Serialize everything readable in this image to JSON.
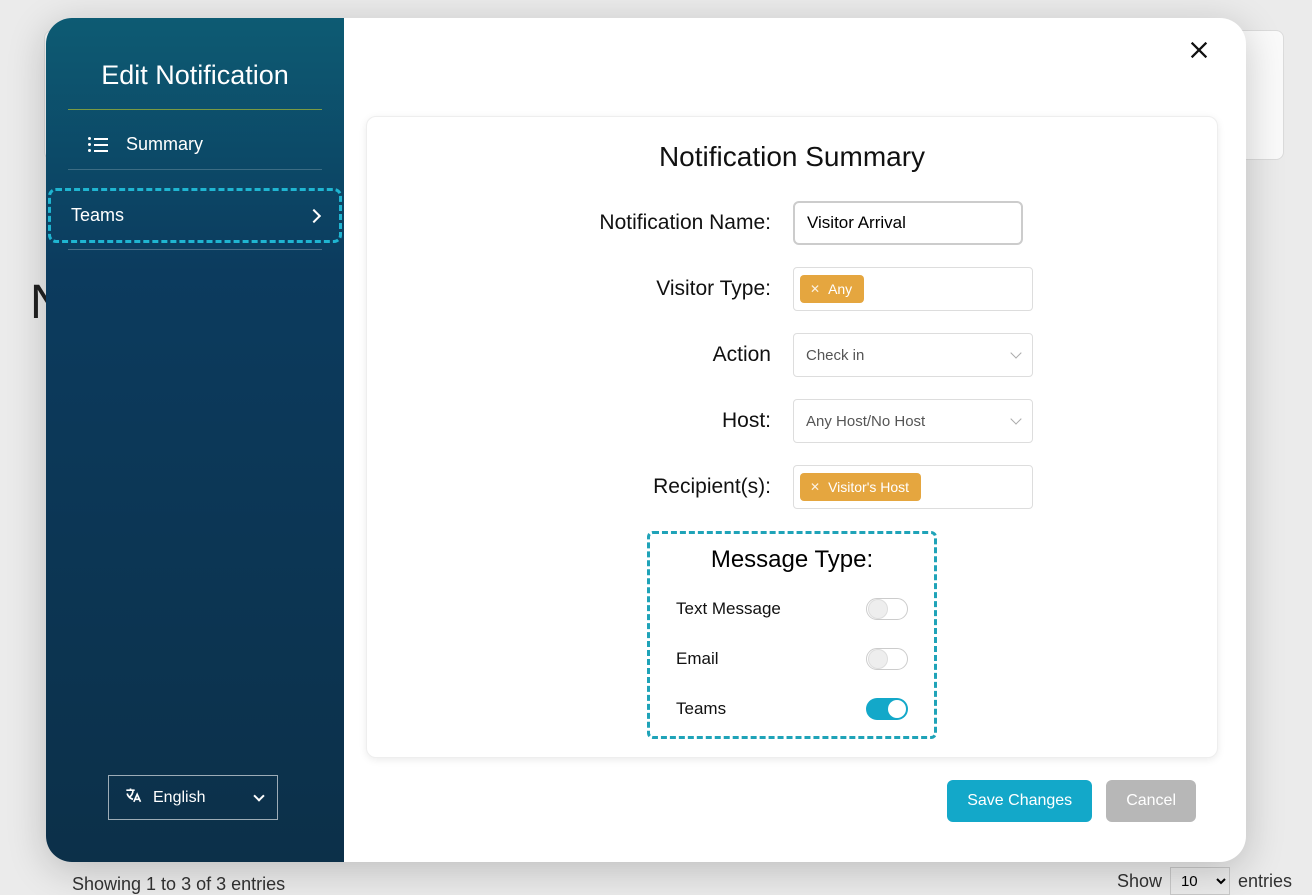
{
  "background": {
    "letter": "N",
    "footer": "Showing 1 to 3 of 3 entries",
    "show_label": "Show",
    "show_value": "10",
    "entries_label": "entries"
  },
  "sidebar": {
    "title": "Edit Notification",
    "summary": "Summary",
    "teams": "Teams",
    "language": "English"
  },
  "content": {
    "title": "Notification Summary",
    "name_label": "Notification Name:",
    "name_value": "Visitor Arrival",
    "visitor_type_label": "Visitor Type:",
    "visitor_type_chip": "Any",
    "action_label": "Action",
    "action_value": "Check in",
    "host_label": "Host:",
    "host_value": "Any Host/No Host",
    "recipients_label": "Recipient(s):",
    "recipients_chip": "Visitor's Host"
  },
  "message_type": {
    "title": "Message Type:",
    "text_message": {
      "label": "Text Message",
      "on": false
    },
    "email": {
      "label": "Email",
      "on": false
    },
    "teams": {
      "label": "Teams",
      "on": true
    }
  },
  "actions": {
    "save": "Save Changes",
    "cancel": "Cancel"
  }
}
